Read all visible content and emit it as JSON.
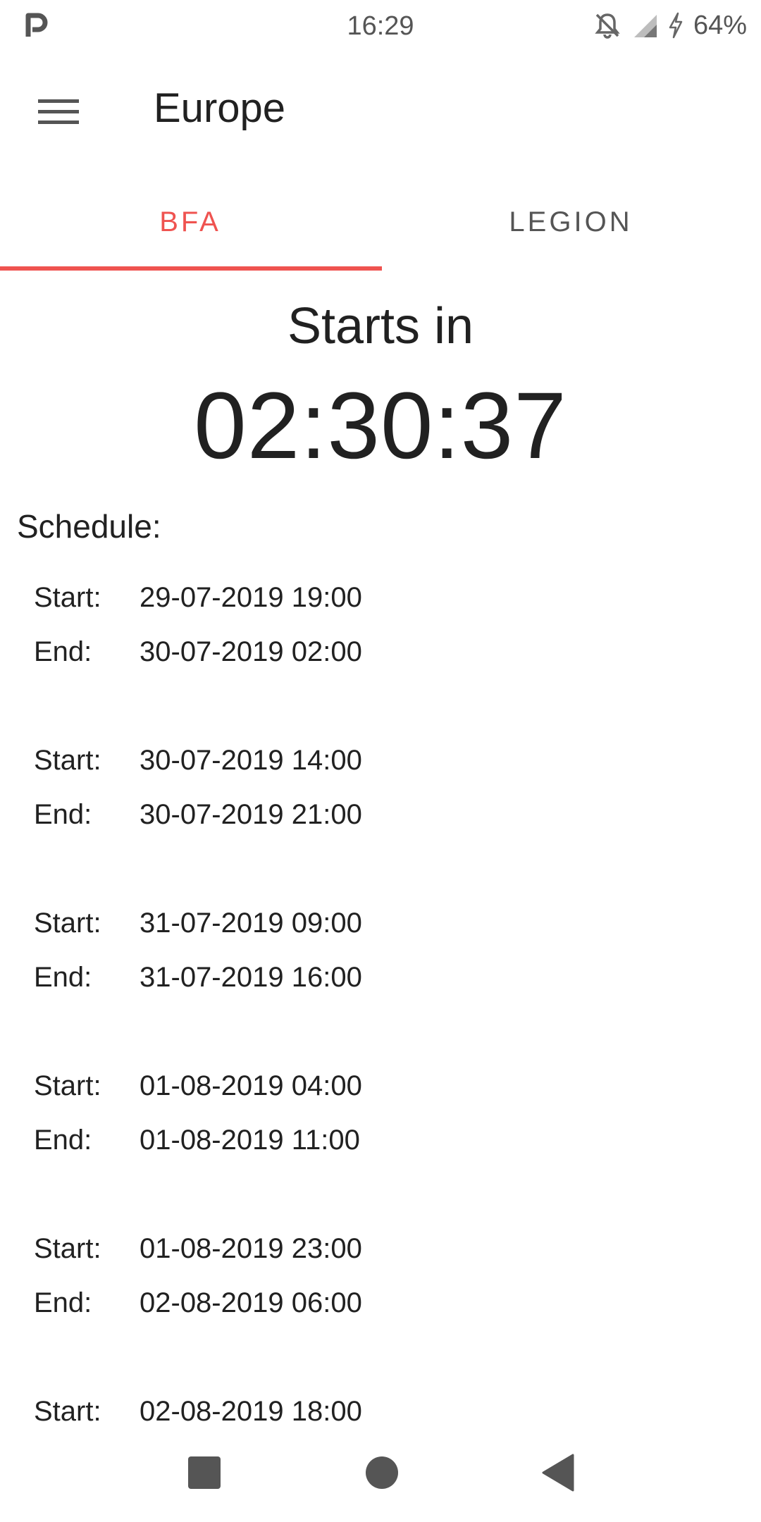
{
  "status_bar": {
    "time": "16:29",
    "battery": "64%",
    "icons": [
      "app-p-icon",
      "notifications-off-icon",
      "signal-icon",
      "charging-icon"
    ]
  },
  "app_bar": {
    "title": "Europe",
    "menu_icon": "hamburger-menu-icon"
  },
  "tabs": [
    {
      "label": "BFA",
      "active": true
    },
    {
      "label": "LEGION",
      "active": false
    }
  ],
  "countdown": {
    "label": "Starts in",
    "value": "02:30:37"
  },
  "schedule": {
    "heading": "Schedule:",
    "start_label": "Start:",
    "end_label": "End:",
    "entries": [
      {
        "start": "29-07-2019 19:00",
        "end": "30-07-2019 02:00"
      },
      {
        "start": "30-07-2019 14:00",
        "end": "30-07-2019 21:00"
      },
      {
        "start": "31-07-2019 09:00",
        "end": "31-07-2019 16:00"
      },
      {
        "start": "01-08-2019 04:00",
        "end": "01-08-2019 11:00"
      },
      {
        "start": "01-08-2019 23:00",
        "end": "02-08-2019 06:00"
      },
      {
        "start": "02-08-2019 18:00",
        "end": ""
      }
    ]
  },
  "nav_bar": {
    "icons": [
      "recents-square-icon",
      "home-circle-icon",
      "back-triangle-icon"
    ]
  },
  "colors": {
    "accent": "#ef5350",
    "text": "#212121",
    "secondary_text": "#555555",
    "background": "#ffffff"
  }
}
